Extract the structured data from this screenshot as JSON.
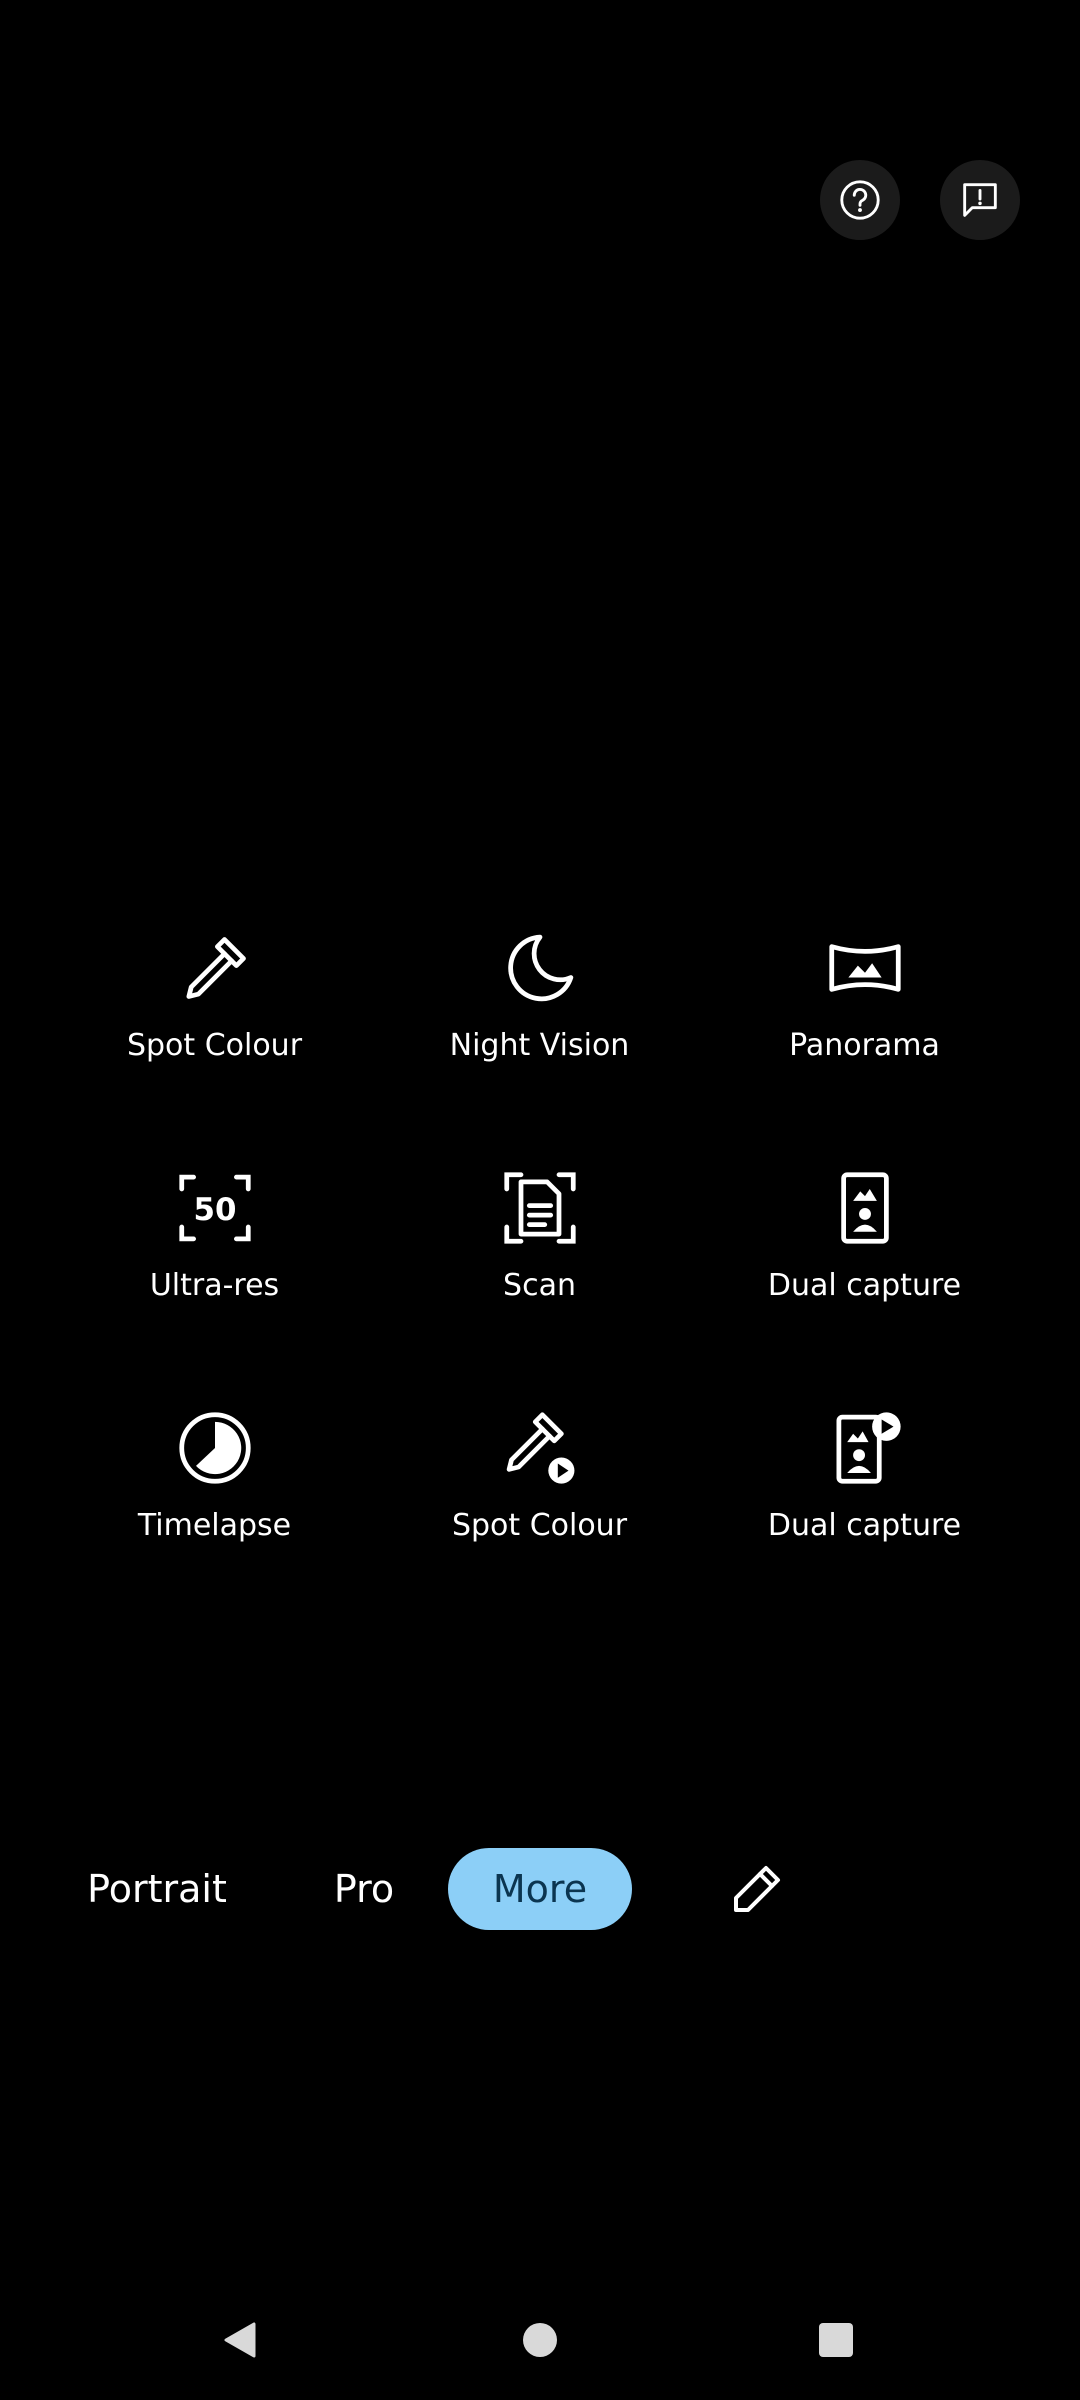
{
  "top_actions": {
    "help_icon": "question-mark-circle",
    "feedback_icon": "feedback-exclamation"
  },
  "modes_grid": [
    {
      "label": "Spot Colour",
      "icon": "eyedropper"
    },
    {
      "label": "Night Vision",
      "icon": "crescent-moon"
    },
    {
      "label": "Panorama",
      "icon": "panorama-frame"
    },
    {
      "label": "Ultra-res",
      "icon": "ultra-res-50"
    },
    {
      "label": "Scan",
      "icon": "document-scan"
    },
    {
      "label": "Dual capture",
      "icon": "dual-capture-photo"
    },
    {
      "label": "Timelapse",
      "icon": "timelapse-pie"
    },
    {
      "label": "Spot Colour",
      "icon": "eyedropper-video"
    },
    {
      "label": "Dual capture",
      "icon": "dual-capture-video"
    }
  ],
  "mode_bar": {
    "portrait": "Portrait",
    "pro": "Pro",
    "more": "More",
    "edit_icon": "pencil",
    "active_color": "#8ccff7"
  },
  "navigation": {
    "back_icon": "triangle-back",
    "home_icon": "circle-home",
    "recents_icon": "square-recents"
  }
}
